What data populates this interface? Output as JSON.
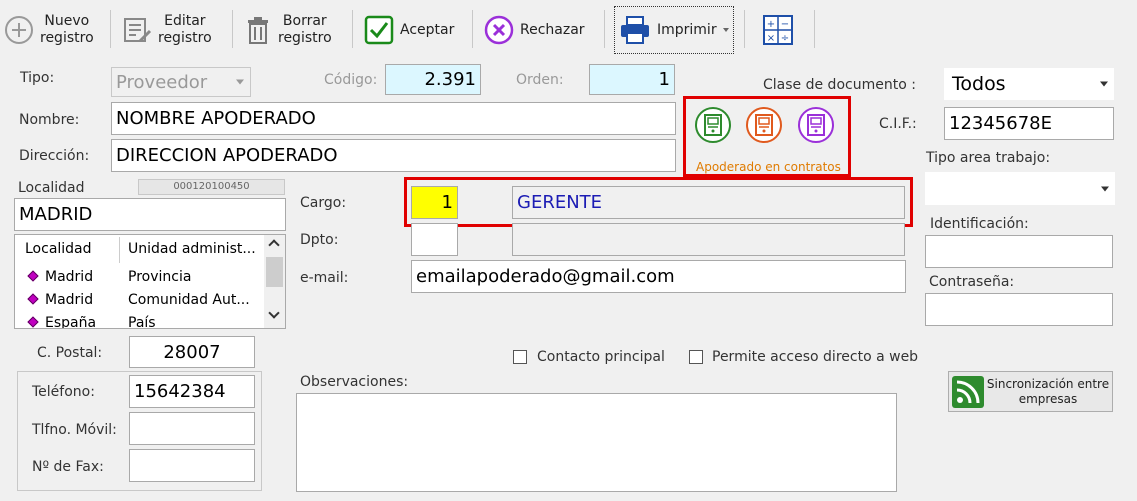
{
  "toolbar": {
    "nuevo_line1": "Nuevo",
    "nuevo_line2": "registro",
    "editar_line1": "Editar",
    "editar_line2": "registro",
    "borrar_line1": "Borrar",
    "borrar_line2": "registro",
    "aceptar": "Aceptar",
    "rechazar": "Rechazar",
    "imprimir": "Imprimir"
  },
  "form": {
    "tipo_label": "Tipo:",
    "tipo_value": "Proveedor",
    "codigo_label": "Código:",
    "codigo_value": "2.391",
    "orden_label": "Orden:",
    "orden_value": "1",
    "clase_label": "Clase de documento :",
    "clase_value": "Todos",
    "nombre_label": "Nombre:",
    "nombre_value": "NOMBRE APODERADO",
    "direccion_label": "Dirección:",
    "direccion_value": "DIRECCION APODERADO",
    "apoderado_caption": "Apoderado en contratos",
    "cif_label": "C.I.F.:",
    "cif_value": "12345678E",
    "tipo_area_label": "Tipo area trabajo:",
    "tipo_area_value": "",
    "localidad_label": "Localidad",
    "localidad_code": "000120100450",
    "localidad_value": "MADRID",
    "cargo_label": "Cargo:",
    "cargo_code": "1",
    "cargo_value": "GERENTE",
    "dpto_label": "Dpto:",
    "dpto_code": "",
    "dpto_value": "",
    "email_label": "e-mail:",
    "email_value": "emailapoderado@gmail.com",
    "identificacion_label": "Identificación:",
    "identificacion_value": "",
    "contrasena_label": "Contraseña:",
    "contrasena_value": "",
    "cpostal_label": "C. Postal:",
    "cpostal_value": "28007",
    "contacto_principal": "Contacto principal",
    "acceso_web": "Permite acceso directo a web",
    "telefono_label": "Teléfono:",
    "telefono_value": "15642384",
    "movil_label": "Tlfno. Móvil:",
    "movil_value": "",
    "fax_label": "Nº de Fax:",
    "fax_value": "",
    "observaciones_label": "Observaciones:",
    "observaciones_value": "",
    "sync_line1": "Sincronización entre",
    "sync_line2": "empresas"
  },
  "localidad_grid": {
    "headers": [
      "Localidad",
      "Unidad administ..."
    ],
    "rows": [
      {
        "localidad": "Madrid",
        "unidad": "Provincia"
      },
      {
        "localidad": "Madrid",
        "unidad": "Comunidad Aut..."
      },
      {
        "localidad": "España",
        "unidad": "País"
      }
    ]
  },
  "colors": {
    "highlight_red": "#e00000",
    "green": "#2e8b2e",
    "orange": "#e05a1e",
    "purple": "#9b30d9",
    "cyan_field": "#dcf7ff",
    "yellow_field": "#ffff00",
    "link_blue": "#1c1cb4"
  }
}
